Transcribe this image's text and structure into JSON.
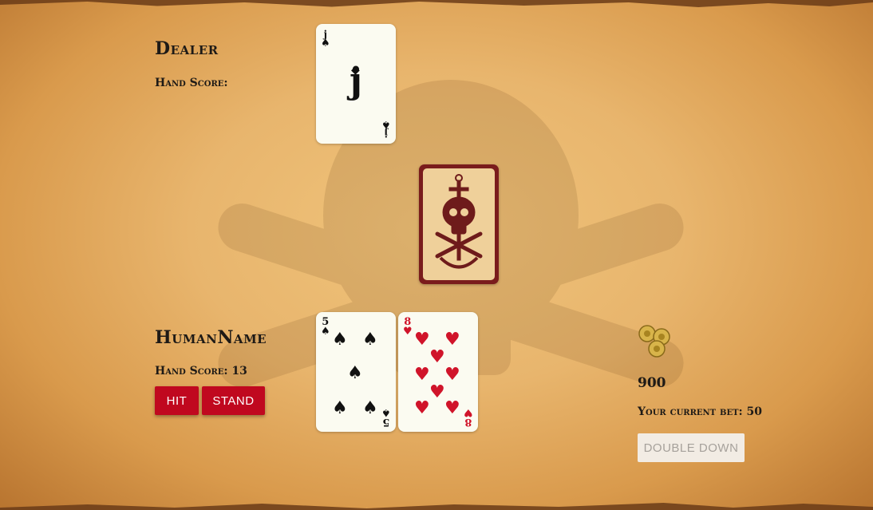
{
  "dealer": {
    "title": "Dealer",
    "hand_score_label": "Hand Score:",
    "cards": [
      {
        "rank": "J",
        "suit": "spade-icon",
        "color": "black"
      }
    ]
  },
  "deck": {
    "icon": "skull-anchor-icon",
    "colors": {
      "border": "#7a1c1c",
      "face": "#efd09a"
    }
  },
  "human": {
    "title": "HumanName",
    "hand_score_label": "Hand Score: 13",
    "buttons": {
      "hit": "HIT",
      "stand": "STAND"
    },
    "cards": [
      {
        "rank": "5",
        "suit": "spade-icon",
        "color": "black"
      },
      {
        "rank": "8",
        "suit": "heart-icon",
        "color": "red"
      }
    ]
  },
  "wallet": {
    "icon": "gold-coins-icon",
    "balance": "900",
    "current_bet_label": "Your current bet: 50",
    "double_down_label": "DOUBLE DOWN"
  },
  "colors": {
    "accent": "#c0081f",
    "parchment": "#e8b56d",
    "text": "#1e1a16"
  }
}
